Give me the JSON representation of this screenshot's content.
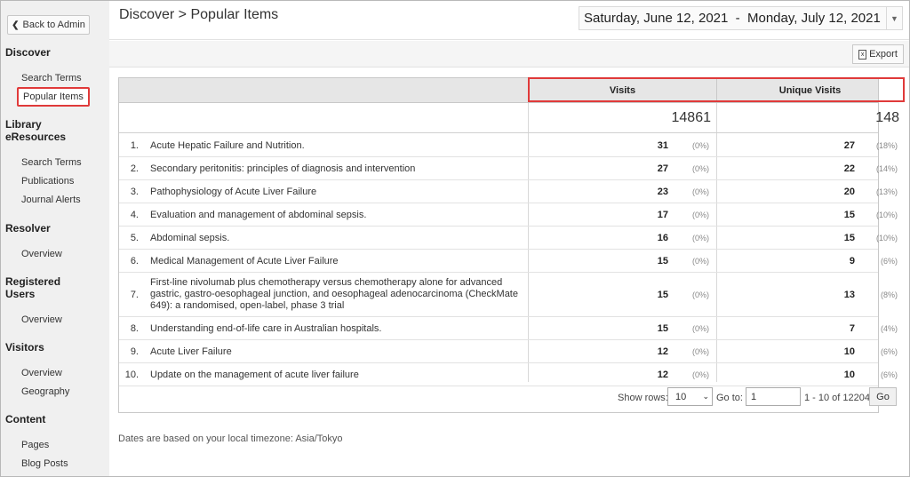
{
  "sidebar": {
    "back_label": "Back to Admin",
    "sections": [
      {
        "title": "Discover",
        "items": [
          "Search Terms",
          "Popular Items"
        ]
      },
      {
        "title": "Library eResources",
        "items": [
          "Search Terms",
          "Publications",
          "Journal Alerts"
        ]
      },
      {
        "title": "Resolver",
        "items": [
          "Overview"
        ]
      },
      {
        "title": "Registered Users",
        "items": [
          "Overview"
        ]
      },
      {
        "title": "Visitors",
        "items": [
          "Overview",
          "Geography"
        ]
      },
      {
        "title": "Content",
        "items": [
          "Pages",
          "Blog Posts"
        ]
      }
    ],
    "active_item": "Popular Items"
  },
  "header": {
    "breadcrumb": "Discover > Popular Items",
    "date_range": "Saturday, June 12, 2021  -  Monday, July 12, 2021"
  },
  "toolbar": {
    "export_label": "Export"
  },
  "table": {
    "columns": [
      "Visits",
      "Unique Visits"
    ],
    "totals": {
      "visits": "14861",
      "unique": "148"
    },
    "rows": [
      {
        "n": "1.",
        "title": "Acute Hepatic Failure and Nutrition.",
        "visits": "31",
        "visits_pct": "(0%)",
        "unique": "27",
        "unique_pct": "(18%)"
      },
      {
        "n": "2.",
        "title": "Secondary peritonitis: principles of diagnosis and intervention",
        "visits": "27",
        "visits_pct": "(0%)",
        "unique": "22",
        "unique_pct": "(14%)"
      },
      {
        "n": "3.",
        "title": "Pathophysiology of Acute Liver Failure",
        "visits": "23",
        "visits_pct": "(0%)",
        "unique": "20",
        "unique_pct": "(13%)"
      },
      {
        "n": "4.",
        "title": "Evaluation and management of abdominal sepsis.",
        "visits": "17",
        "visits_pct": "(0%)",
        "unique": "15",
        "unique_pct": "(10%)"
      },
      {
        "n": "5.",
        "title": "Abdominal sepsis.",
        "visits": "16",
        "visits_pct": "(0%)",
        "unique": "15",
        "unique_pct": "(10%)"
      },
      {
        "n": "6.",
        "title": "Medical Management of Acute Liver Failure",
        "visits": "15",
        "visits_pct": "(0%)",
        "unique": "9",
        "unique_pct": "(6%)"
      },
      {
        "n": "7.",
        "title": "First-line nivolumab plus chemotherapy versus chemotherapy alone for advanced gastric, gastro-oesophageal junction, and oesophageal adenocarcinoma (CheckMate 649): a randomised, open-label, phase 3 trial",
        "visits": "15",
        "visits_pct": "(0%)",
        "unique": "13",
        "unique_pct": "(8%)"
      },
      {
        "n": "8.",
        "title": "Understanding end-of-life care in Australian hospitals.",
        "visits": "15",
        "visits_pct": "(0%)",
        "unique": "7",
        "unique_pct": "(4%)"
      },
      {
        "n": "9.",
        "title": "Acute Liver Failure",
        "visits": "12",
        "visits_pct": "(0%)",
        "unique": "10",
        "unique_pct": "(6%)"
      },
      {
        "n": "10.",
        "title": "Update on the management of acute liver failure",
        "visits": "12",
        "visits_pct": "(0%)",
        "unique": "10",
        "unique_pct": "(6%)"
      }
    ]
  },
  "pager": {
    "show_rows_label": "Show rows:",
    "rows_value": "10",
    "goto_label": "Go to:",
    "goto_value": "1",
    "range_text": "1 - 10 of 12204",
    "go_label": "Go"
  },
  "timezone_note": "Dates are based on your local timezone: Asia/Tokyo",
  "colors": {
    "highlight": "#e03a3a",
    "sidebar_bg": "#f0f0f0"
  }
}
